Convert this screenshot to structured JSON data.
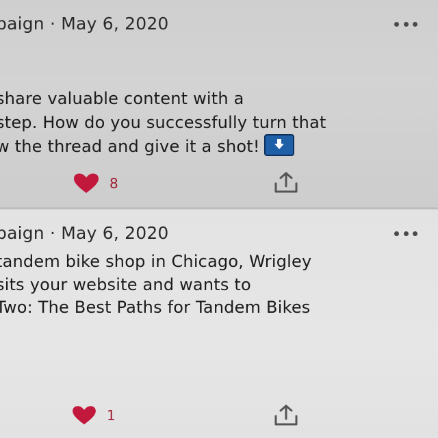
{
  "posts": [
    {
      "meta": "paign · May 6, 2020",
      "lines": [
        "share valuable content with a",
        "step. How do you successfully turn that",
        "w the thread and give it a shot!"
      ],
      "likes": "8"
    },
    {
      "meta": "paign · May 6, 2020",
      "lines": [
        "tandem bike shop in Chicago, Wrigley",
        "sits your website and wants to",
        "Two: The Best Paths for Tandem Bikes"
      ],
      "likes": "1"
    }
  ],
  "icons": {
    "more": "more-horizontal-icon",
    "like": "heart-icon",
    "share": "share-icon",
    "down": "down-arrow-emoji-icon"
  },
  "colors": {
    "heart": "#c2183b",
    "like_count": "#9b1b30",
    "down_badge": "#1f5fa8"
  }
}
